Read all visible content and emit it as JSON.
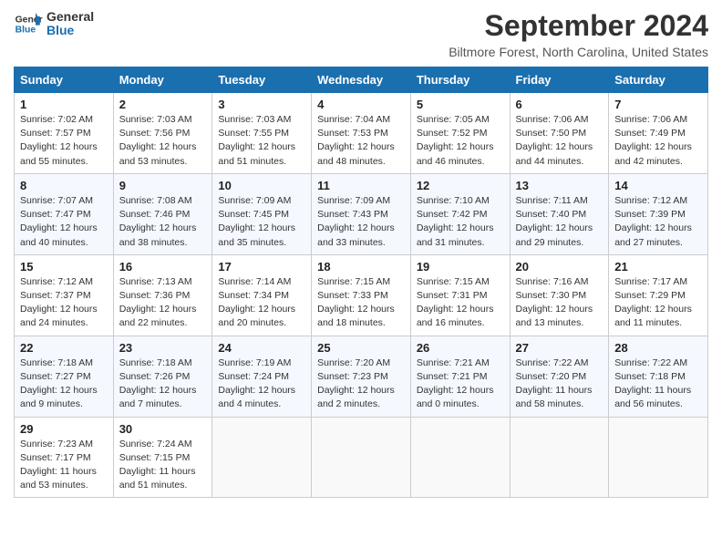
{
  "logo": {
    "name_part1": "General",
    "name_part2": "Blue"
  },
  "title": "September 2024",
  "subtitle": "Biltmore Forest, North Carolina, United States",
  "weekdays": [
    "Sunday",
    "Monday",
    "Tuesday",
    "Wednesday",
    "Thursday",
    "Friday",
    "Saturday"
  ],
  "weeks": [
    [
      {
        "day": "1",
        "info": "Sunrise: 7:02 AM\nSunset: 7:57 PM\nDaylight: 12 hours\nand 55 minutes."
      },
      {
        "day": "2",
        "info": "Sunrise: 7:03 AM\nSunset: 7:56 PM\nDaylight: 12 hours\nand 53 minutes."
      },
      {
        "day": "3",
        "info": "Sunrise: 7:03 AM\nSunset: 7:55 PM\nDaylight: 12 hours\nand 51 minutes."
      },
      {
        "day": "4",
        "info": "Sunrise: 7:04 AM\nSunset: 7:53 PM\nDaylight: 12 hours\nand 48 minutes."
      },
      {
        "day": "5",
        "info": "Sunrise: 7:05 AM\nSunset: 7:52 PM\nDaylight: 12 hours\nand 46 minutes."
      },
      {
        "day": "6",
        "info": "Sunrise: 7:06 AM\nSunset: 7:50 PM\nDaylight: 12 hours\nand 44 minutes."
      },
      {
        "day": "7",
        "info": "Sunrise: 7:06 AM\nSunset: 7:49 PM\nDaylight: 12 hours\nand 42 minutes."
      }
    ],
    [
      {
        "day": "8",
        "info": "Sunrise: 7:07 AM\nSunset: 7:47 PM\nDaylight: 12 hours\nand 40 minutes."
      },
      {
        "day": "9",
        "info": "Sunrise: 7:08 AM\nSunset: 7:46 PM\nDaylight: 12 hours\nand 38 minutes."
      },
      {
        "day": "10",
        "info": "Sunrise: 7:09 AM\nSunset: 7:45 PM\nDaylight: 12 hours\nand 35 minutes."
      },
      {
        "day": "11",
        "info": "Sunrise: 7:09 AM\nSunset: 7:43 PM\nDaylight: 12 hours\nand 33 minutes."
      },
      {
        "day": "12",
        "info": "Sunrise: 7:10 AM\nSunset: 7:42 PM\nDaylight: 12 hours\nand 31 minutes."
      },
      {
        "day": "13",
        "info": "Sunrise: 7:11 AM\nSunset: 7:40 PM\nDaylight: 12 hours\nand 29 minutes."
      },
      {
        "day": "14",
        "info": "Sunrise: 7:12 AM\nSunset: 7:39 PM\nDaylight: 12 hours\nand 27 minutes."
      }
    ],
    [
      {
        "day": "15",
        "info": "Sunrise: 7:12 AM\nSunset: 7:37 PM\nDaylight: 12 hours\nand 24 minutes."
      },
      {
        "day": "16",
        "info": "Sunrise: 7:13 AM\nSunset: 7:36 PM\nDaylight: 12 hours\nand 22 minutes."
      },
      {
        "day": "17",
        "info": "Sunrise: 7:14 AM\nSunset: 7:34 PM\nDaylight: 12 hours\nand 20 minutes."
      },
      {
        "day": "18",
        "info": "Sunrise: 7:15 AM\nSunset: 7:33 PM\nDaylight: 12 hours\nand 18 minutes."
      },
      {
        "day": "19",
        "info": "Sunrise: 7:15 AM\nSunset: 7:31 PM\nDaylight: 12 hours\nand 16 minutes."
      },
      {
        "day": "20",
        "info": "Sunrise: 7:16 AM\nSunset: 7:30 PM\nDaylight: 12 hours\nand 13 minutes."
      },
      {
        "day": "21",
        "info": "Sunrise: 7:17 AM\nSunset: 7:29 PM\nDaylight: 12 hours\nand 11 minutes."
      }
    ],
    [
      {
        "day": "22",
        "info": "Sunrise: 7:18 AM\nSunset: 7:27 PM\nDaylight: 12 hours\nand 9 minutes."
      },
      {
        "day": "23",
        "info": "Sunrise: 7:18 AM\nSunset: 7:26 PM\nDaylight: 12 hours\nand 7 minutes."
      },
      {
        "day": "24",
        "info": "Sunrise: 7:19 AM\nSunset: 7:24 PM\nDaylight: 12 hours\nand 4 minutes."
      },
      {
        "day": "25",
        "info": "Sunrise: 7:20 AM\nSunset: 7:23 PM\nDaylight: 12 hours\nand 2 minutes."
      },
      {
        "day": "26",
        "info": "Sunrise: 7:21 AM\nSunset: 7:21 PM\nDaylight: 12 hours\nand 0 minutes."
      },
      {
        "day": "27",
        "info": "Sunrise: 7:22 AM\nSunset: 7:20 PM\nDaylight: 11 hours\nand 58 minutes."
      },
      {
        "day": "28",
        "info": "Sunrise: 7:22 AM\nSunset: 7:18 PM\nDaylight: 11 hours\nand 56 minutes."
      }
    ],
    [
      {
        "day": "29",
        "info": "Sunrise: 7:23 AM\nSunset: 7:17 PM\nDaylight: 11 hours\nand 53 minutes."
      },
      {
        "day": "30",
        "info": "Sunrise: 7:24 AM\nSunset: 7:15 PM\nDaylight: 11 hours\nand 51 minutes."
      },
      {
        "day": "",
        "info": ""
      },
      {
        "day": "",
        "info": ""
      },
      {
        "day": "",
        "info": ""
      },
      {
        "day": "",
        "info": ""
      },
      {
        "day": "",
        "info": ""
      }
    ]
  ]
}
